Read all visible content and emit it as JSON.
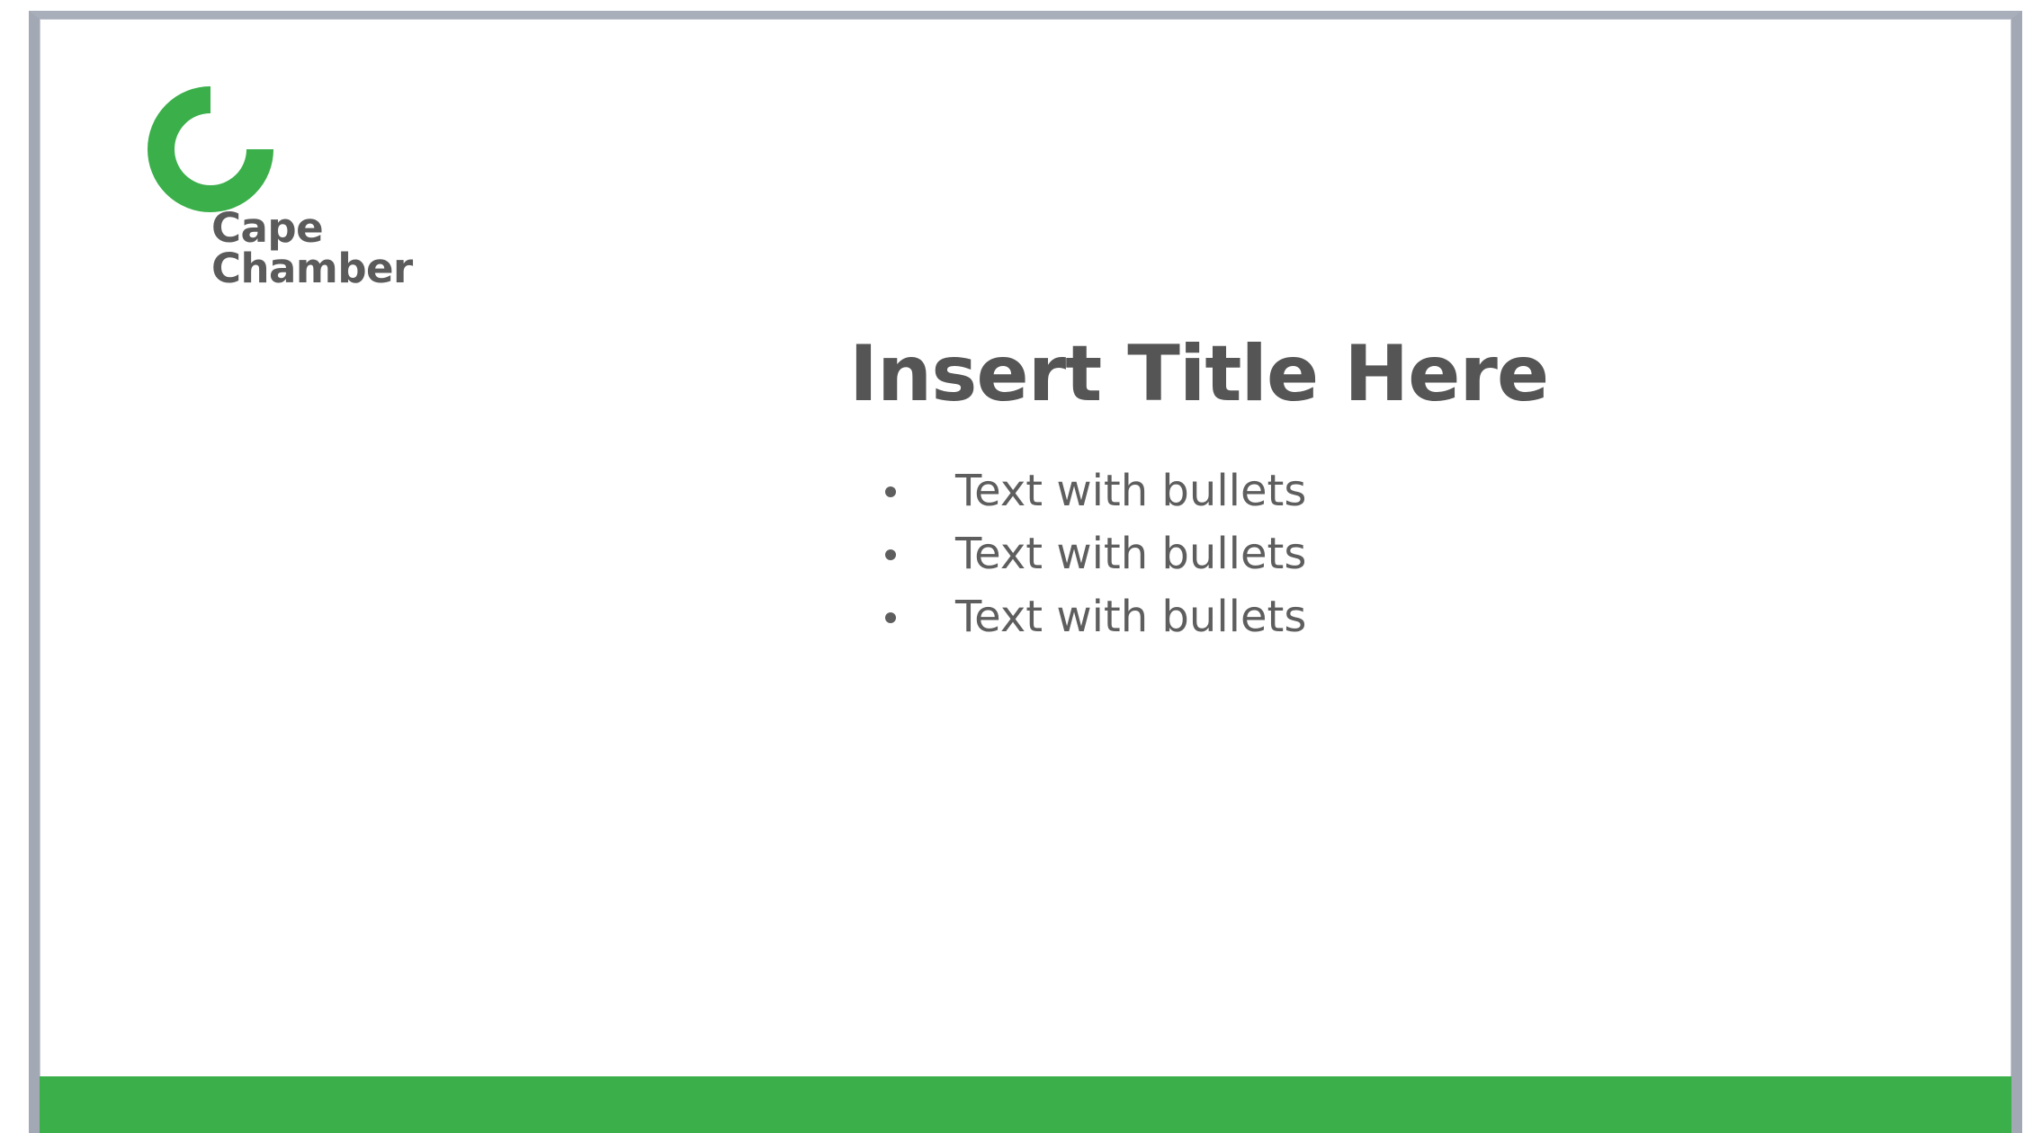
{
  "slide": {
    "logo": {
      "line1": "Cape",
      "line2": "Chamber",
      "mark_icon": "open-ring-logo-icon"
    },
    "title": "Insert Title Here",
    "bullets": [
      "Text with bullets",
      "Text with bullets",
      "Text with bullets"
    ]
  },
  "colors": {
    "brand_green": "#3AAF4A",
    "text_gray": "#555555",
    "frame_gray": "#A3A8B5"
  }
}
